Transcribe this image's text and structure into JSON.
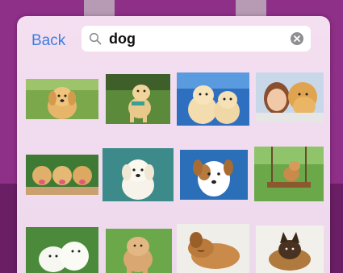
{
  "nav": {
    "back_label": "Back"
  },
  "search": {
    "query": "dog",
    "search_icon": "search-icon",
    "clear_icon": "clear-icon"
  },
  "colors": {
    "background_purple": "#8e2f88",
    "popover_pink": "#f4dff1",
    "accent_blue": "#3c7ee0"
  },
  "results": [
    {
      "name": "result-golden-retriever-puppy"
    },
    {
      "name": "result-puppy-on-grass"
    },
    {
      "name": "result-two-retriever-puppies"
    },
    {
      "name": "result-woman-with-golden-retriever"
    },
    {
      "name": "result-three-puppies"
    },
    {
      "name": "result-white-puppy"
    },
    {
      "name": "result-jack-russell"
    },
    {
      "name": "result-dog-on-swing"
    },
    {
      "name": "result-samoyed-puppies"
    },
    {
      "name": "result-chow-puppy"
    },
    {
      "name": "result-sleeping-puppy"
    },
    {
      "name": "result-shepherd-puppy"
    }
  ]
}
